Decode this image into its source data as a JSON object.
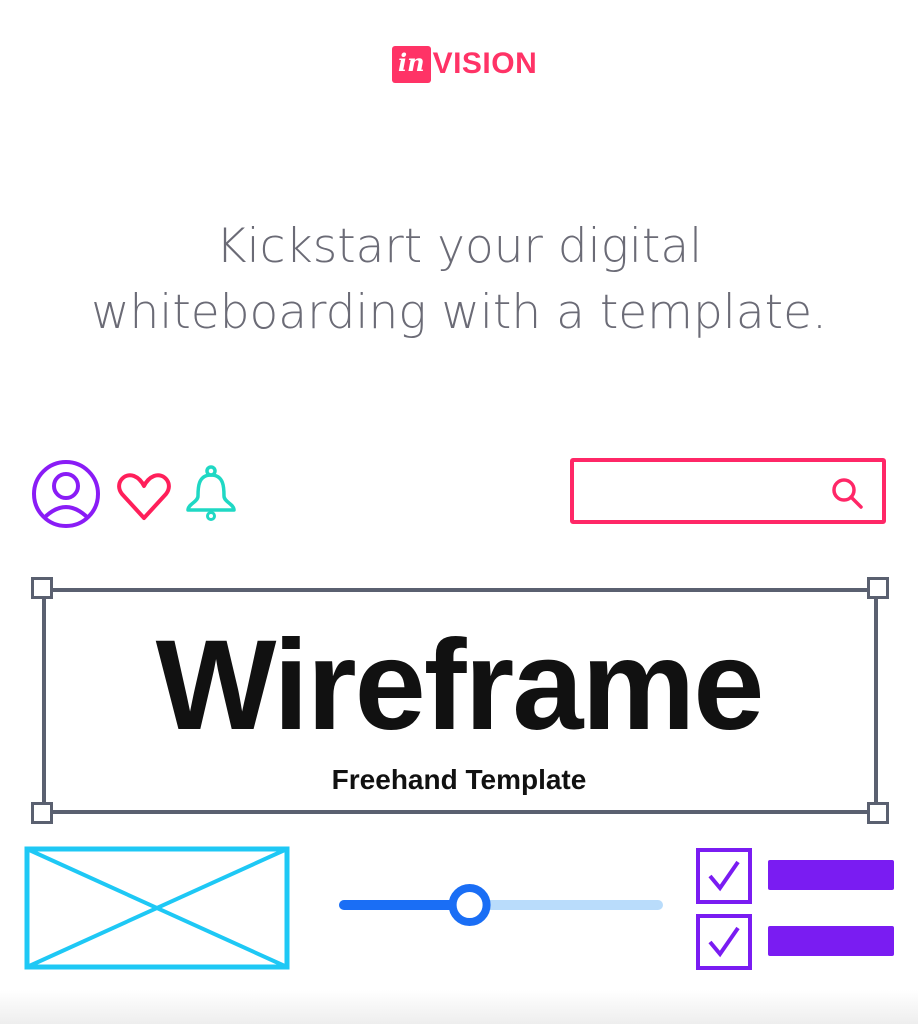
{
  "logo": {
    "brand_box": "in",
    "brand_rest": "VISION"
  },
  "headline": {
    "line1": "Kickstart your digital",
    "line2": "whiteboarding with a template."
  },
  "template": {
    "title": "Wireframe",
    "subtitle": "Freehand Template"
  },
  "slider": {
    "value_percent": 40
  },
  "checklist": {
    "items_checked": [
      true,
      true
    ]
  },
  "colors": {
    "brand": "#ff3366",
    "purple": "#7a1cf2",
    "teal": "#1fd8c4",
    "cyan": "#1ec8f5",
    "blue": "#1a6ef5"
  }
}
